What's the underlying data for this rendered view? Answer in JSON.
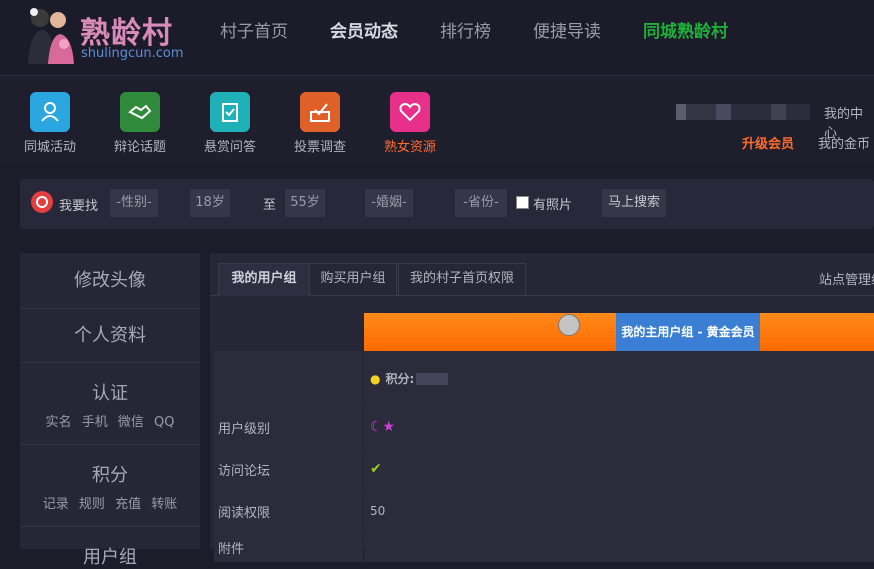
{
  "brand": {
    "title": "熟龄村",
    "subtitle": "shulingcun.com"
  },
  "nav": [
    {
      "label": "村子首页"
    },
    {
      "label": "会员动态"
    },
    {
      "label": "排行榜"
    },
    {
      "label": "便捷导读"
    },
    {
      "label": "同城熟龄村"
    }
  ],
  "quick_icons": [
    {
      "label": "同城活动",
      "color": "#2aa6e0",
      "icon": "user-pin-icon"
    },
    {
      "label": "辩论话题",
      "color": "#2f8a3c",
      "icon": "handshake-icon"
    },
    {
      "label": "悬赏问答",
      "color": "#1fb0b8",
      "icon": "clipboard-check-icon"
    },
    {
      "label": "投票调查",
      "color": "#e0602a",
      "icon": "ballot-box-icon"
    },
    {
      "label": "熟女资源",
      "color": "#e8308a",
      "icon": "hearts-icon"
    }
  ],
  "user": {
    "center": "我的中心",
    "upgrade": "升级会员",
    "coins": "我的金币"
  },
  "search": {
    "label": "我要找",
    "gender": "-性别-",
    "age_from": "18岁",
    "to": "至",
    "age_to": "55岁",
    "marriage": "-婚姻-",
    "province": "-省份-",
    "has_photo": "有照片",
    "submit": "马上搜索"
  },
  "sidebar": [
    {
      "title": "修改头像",
      "links": []
    },
    {
      "title": "个人资料",
      "links": []
    },
    {
      "title": "认证",
      "links": [
        "实名",
        "手机",
        "微信",
        "QQ"
      ]
    },
    {
      "title": "积分",
      "links": [
        "记录",
        "规则",
        "充值",
        "转账"
      ]
    },
    {
      "title": "用户组",
      "links": []
    }
  ],
  "tabs": [
    {
      "label": "我的用户组"
    },
    {
      "label": "购买用户组"
    },
    {
      "label": "我的村子首页权限"
    }
  ],
  "admin_label": "站点管理组",
  "group_bar": {
    "label": "我的主用户组 - 黄金会员"
  },
  "rows": [
    {
      "label": "",
      "value": "积分:"
    },
    {
      "label": "用户级别",
      "value": "☾★"
    },
    {
      "label": "访问论坛",
      "value": "✔"
    },
    {
      "label": "阅读权限",
      "value": "50"
    },
    {
      "label": "附件",
      "value": ""
    }
  ]
}
